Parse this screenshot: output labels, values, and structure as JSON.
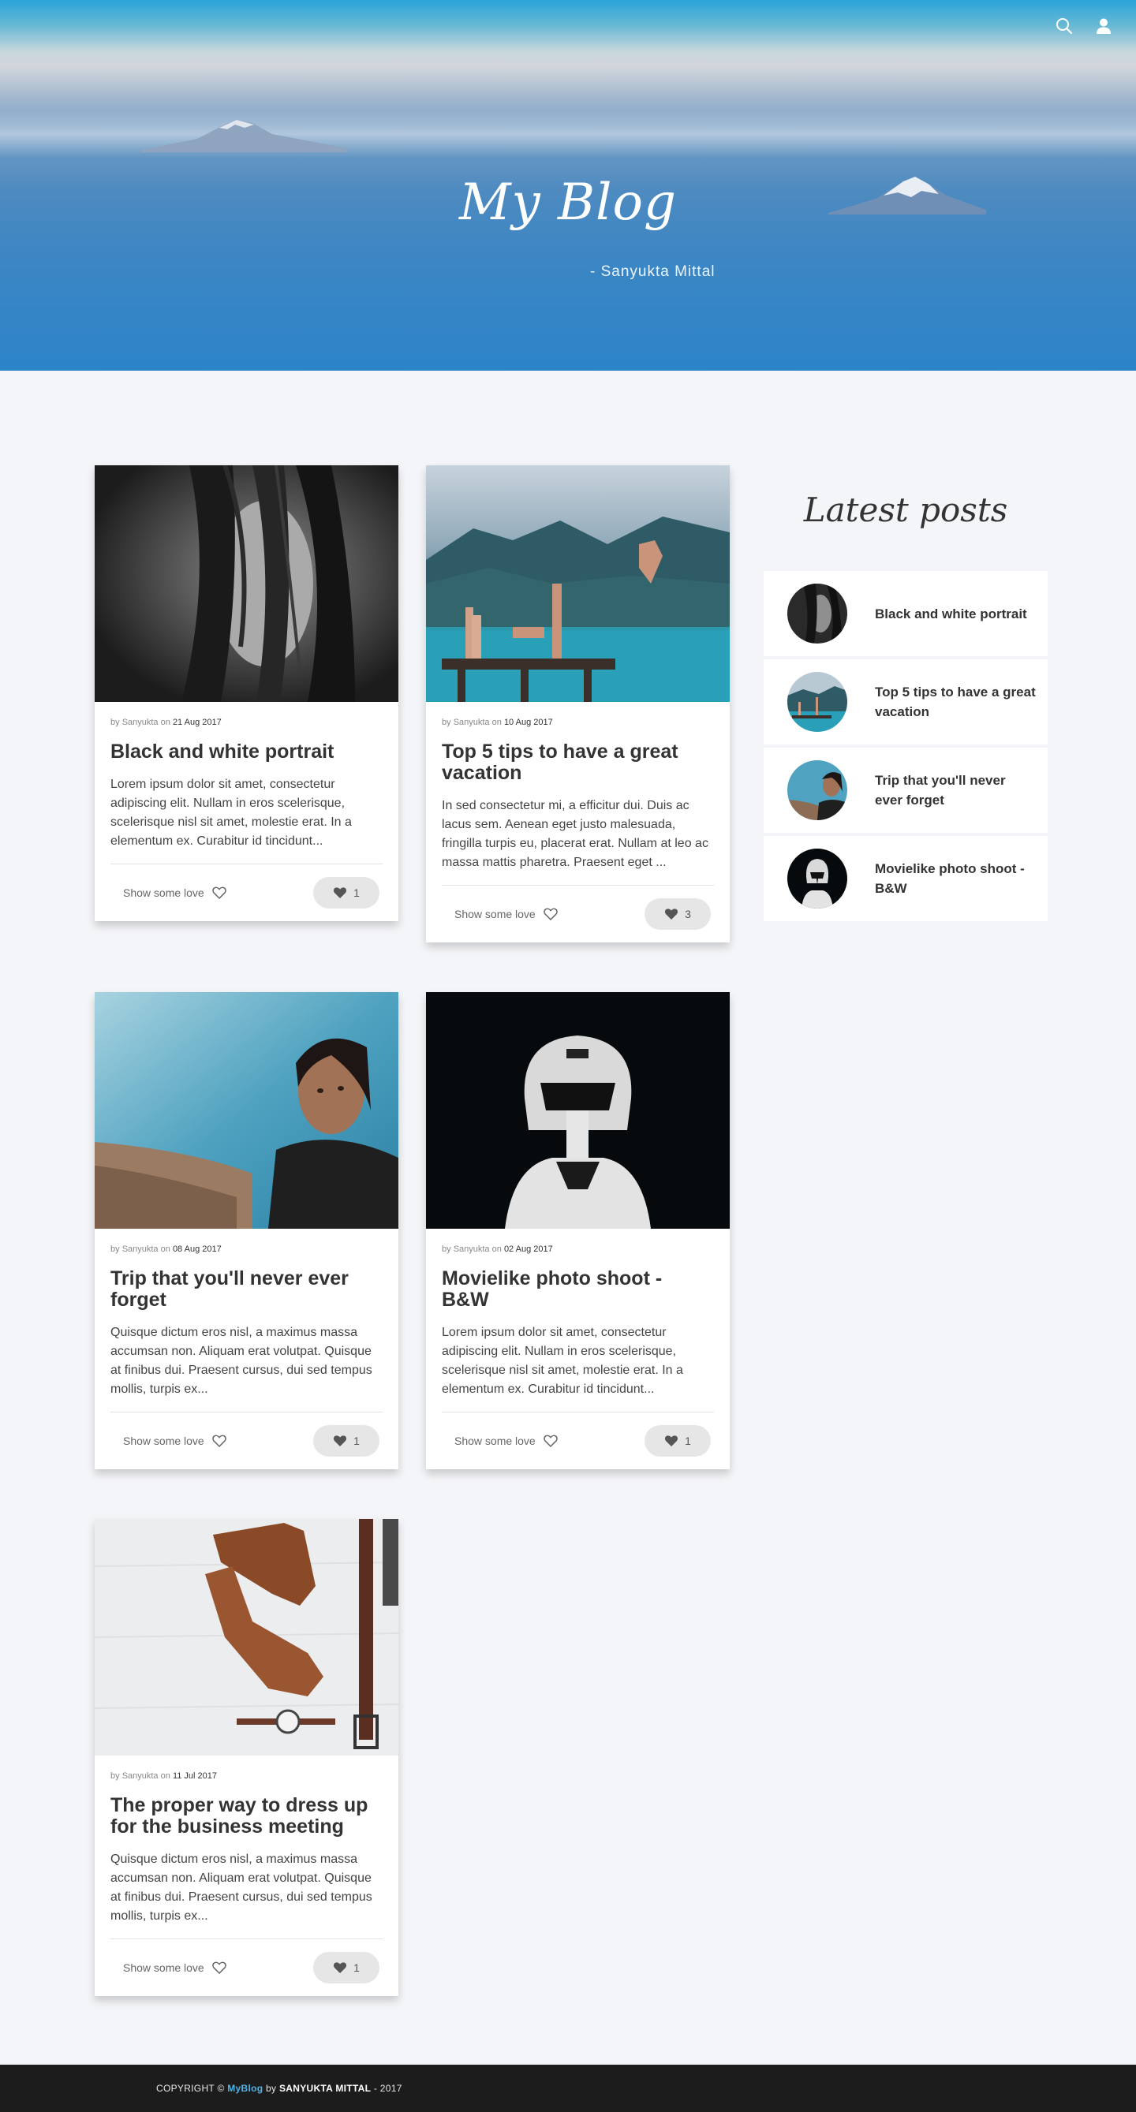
{
  "header": {
    "title": "My Blog",
    "subtitle": "- Sanyukta Mittal",
    "icons": [
      "search-icon",
      "user-icon"
    ]
  },
  "posts": [
    {
      "author": "Sanyukta",
      "date": "21 Aug 2017",
      "title": "Black and white portrait",
      "excerpt": "Lorem ipsum dolor sit amet, consectetur adipiscing elit. Nullam in eros scelerisque, scelerisque nisl sit amet, molestie erat. In a elementum ex. Curabitur id tincidunt...",
      "love_label": "Show some love",
      "likes": "1"
    },
    {
      "author": "Sanyukta",
      "date": "10 Aug 2017",
      "title": "Top 5 tips to have a great vacation",
      "excerpt": "In sed consectetur mi, a efficitur dui. Duis ac lacus sem. Aenean eget justo malesuada, fringilla turpis eu, placerat erat. Nullam at leo ac massa mattis pharetra. Praesent eget ...",
      "love_label": "Show some love",
      "likes": "3"
    },
    {
      "author": "Sanyukta",
      "date": "08 Aug 2017",
      "title": "Trip that you'll never ever forget",
      "excerpt": "Quisque dictum eros nisl, a maximus massa accumsan non. Aliquam erat volutpat. Quisque at finibus dui. Praesent cursus, dui sed tempus mollis, turpis ex...",
      "love_label": "Show some love",
      "likes": "1"
    },
    {
      "author": "Sanyukta",
      "date": "02 Aug 2017",
      "title": "Movielike photo shoot - B&W",
      "excerpt": "Lorem ipsum dolor sit amet, consectetur adipiscing elit. Nullam in eros scelerisque, scelerisque nisl sit amet, molestie erat. In a elementum ex. Curabitur id tincidunt...",
      "love_label": "Show some love",
      "likes": "1"
    },
    {
      "author": "Sanyukta",
      "date": "11 Jul 2017",
      "title": "The proper way to dress up for the business meeting",
      "excerpt": "Quisque dictum eros nisl, a maximus massa accumsan non. Aliquam erat volutpat. Quisque at finibus dui. Praesent cursus, dui sed tempus mollis, turpis ex...",
      "love_label": "Show some love",
      "likes": "1"
    }
  ],
  "meta_by": "by",
  "meta_on": "on",
  "sidebar": {
    "title": "Latest posts",
    "items": [
      {
        "title": "Black and white portrait"
      },
      {
        "title": "Top 5 tips to have a great vacation"
      },
      {
        "title": "Trip that you'll never ever forget"
      },
      {
        "title": "Movielike photo shoot - B&W"
      }
    ]
  },
  "footer": {
    "copyright": "COPYRIGHT ©",
    "brand": "MyBlog",
    "by": "by",
    "author": "SANYUKTA MITTAL",
    "year": "- 2017"
  },
  "colors": {
    "accent": "#4fb3e6",
    "footer_bg": "#1c1c1c",
    "page_bg": "#f4f5f8",
    "like_pill": "#e6e6e6"
  }
}
